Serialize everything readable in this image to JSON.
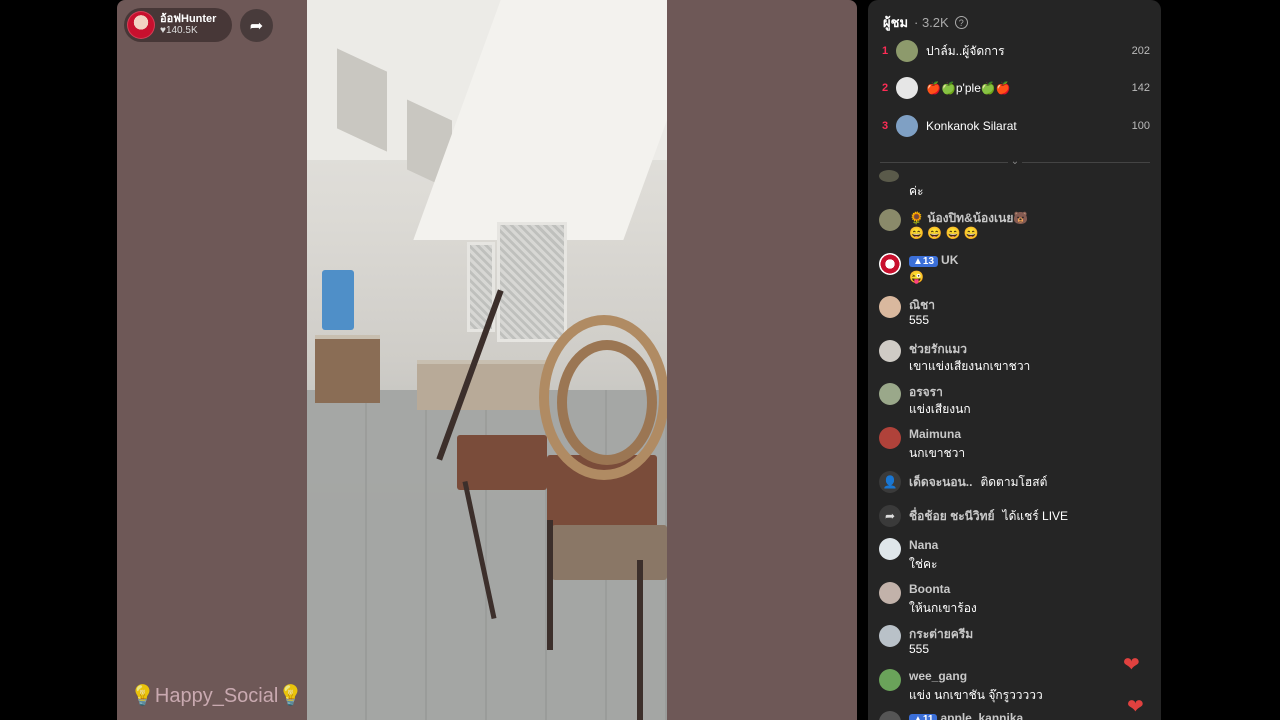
{
  "stream": {
    "host_name": "อ้อฟHunter",
    "host_likes": "140.5K",
    "watermark": "💡Happy_Social💡"
  },
  "colors": {
    "side_panel": "#6e5857",
    "chat_bg": "#252525",
    "rank_accent": "#fe2c55",
    "heart": "#e0413f"
  },
  "viewers": {
    "title": "ผู้ชม",
    "count": "· 3.2K"
  },
  "ranking": [
    {
      "rank": "1",
      "name": "ปาล์ม..ผู้จัดการ",
      "score": "202"
    },
    {
      "rank": "2",
      "name": "🍎🍏p'ple🍏🍎",
      "score": "142"
    },
    {
      "rank": "3",
      "name": "Konkanok Silarat",
      "score": "100"
    }
  ],
  "chat": {
    "partial_text": "ค่ะ",
    "messages": [
      {
        "user": "🌻 น้องปิท&น้องเนย🐻",
        "text": "😄 😄 😄 😄"
      },
      {
        "user": "UK",
        "badge": "13",
        "text": "😜"
      },
      {
        "user": "ณิชา",
        "text": "555"
      },
      {
        "user": "ช่วยรักแมว",
        "text": "เขาแข่งเสียงนกเขาชวา"
      },
      {
        "user": "อรจรา",
        "text": "แข่งเสียงนก"
      },
      {
        "user": "Maimuna",
        "text": "นกเขาชวา"
      },
      {
        "user": "Nana",
        "text": "ใช่คะ"
      },
      {
        "user": "Boonta",
        "text": "ให้นกเขาร้อง"
      },
      {
        "user": "กระต่ายครีม",
        "text": "555"
      },
      {
        "user": "wee_gang",
        "text": "แข่ง นกเขาชัน จุ๊กรูววววว"
      }
    ],
    "system": [
      {
        "user": "เด็ดจะนอน..",
        "action": "ติดตามโฮสต์",
        "icon": "follow-icon"
      },
      {
        "user": "ชื่อช้อย ชะนีวิทย์",
        "action": "ได้แชร์ LIVE",
        "icon": "share-icon"
      }
    ],
    "last_user": "apple_kannika",
    "last_badge": "11"
  }
}
